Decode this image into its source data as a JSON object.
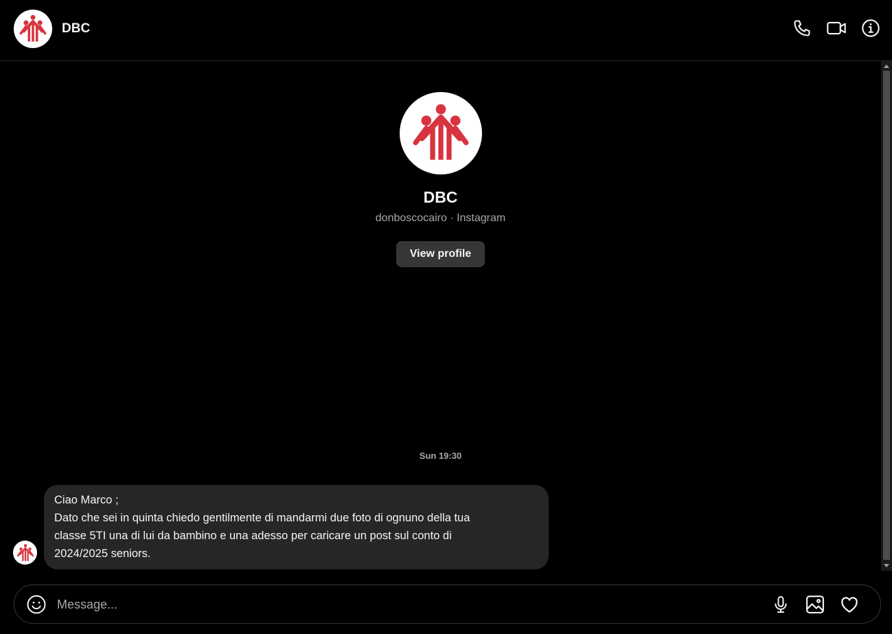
{
  "header": {
    "title": "DBC",
    "avatar_icon": "salesian-logo-icon",
    "actions": [
      "phone-icon",
      "video-call-icon",
      "info-icon"
    ]
  },
  "profile": {
    "name": "DBC",
    "subtitle": "donboscocairo · Instagram",
    "view_profile_label": "View profile"
  },
  "conversation": {
    "timestamp": "Sun 19:30",
    "messages": [
      {
        "lines": [
          "Ciao Marco ;",
          "Dato che sei in quinta chiedo gentilmente di mandarmi due foto di ognuno della tua",
          "classe 5TI una di lui da bambino e una adesso per caricare un post sul conto di",
          "2024/2025 seniors."
        ]
      }
    ]
  },
  "composer": {
    "placeholder": "Message...",
    "icons": [
      "emoji-icon",
      "microphone-icon",
      "image-icon",
      "heart-icon"
    ]
  },
  "colors": {
    "background": "#000000",
    "bubble": "#262626",
    "button": "#363636",
    "logo_red": "#d7343f",
    "muted_text": "#a8a8a8"
  }
}
